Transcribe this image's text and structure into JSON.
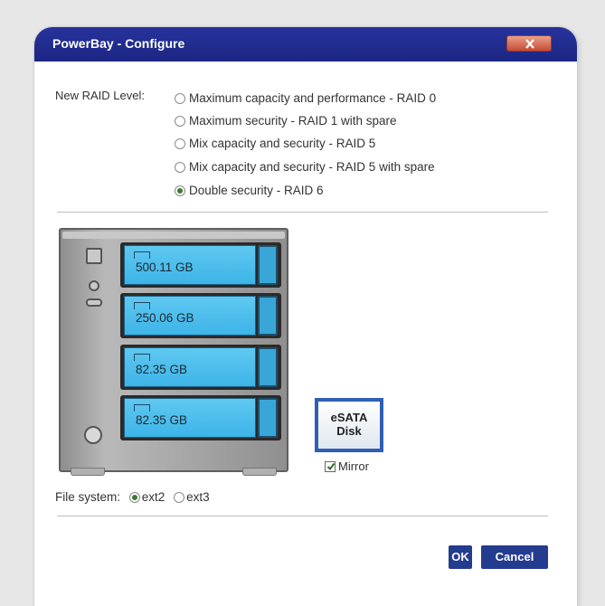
{
  "window": {
    "title": "PowerBay - Configure"
  },
  "raid": {
    "label": "New RAID Level:",
    "options": [
      {
        "label": "Maximum capacity and performance - RAID 0",
        "selected": false
      },
      {
        "label": "Maximum security - RAID 1 with spare",
        "selected": false
      },
      {
        "label": "Mix capacity and security - RAID 5",
        "selected": false
      },
      {
        "label": "Mix capacity and security - RAID 5 with spare",
        "selected": false
      },
      {
        "label": "Double security - RAID 6",
        "selected": true
      }
    ]
  },
  "bays": [
    {
      "size": "500.11 GB"
    },
    {
      "size": "250.06 GB"
    },
    {
      "size": "82.35 GB"
    },
    {
      "size": "82.35 GB"
    }
  ],
  "esata": {
    "line1": "eSATA",
    "line2": "Disk",
    "mirror_label": "Mirror",
    "mirror_checked": true
  },
  "filesystem": {
    "label": "File system:",
    "options": [
      {
        "label": "ext2",
        "selected": true
      },
      {
        "label": "ext3",
        "selected": false
      }
    ]
  },
  "buttons": {
    "ok": "OK",
    "cancel": "Cancel"
  },
  "icons": {
    "close": "close-icon",
    "check": "checkmark-icon"
  }
}
